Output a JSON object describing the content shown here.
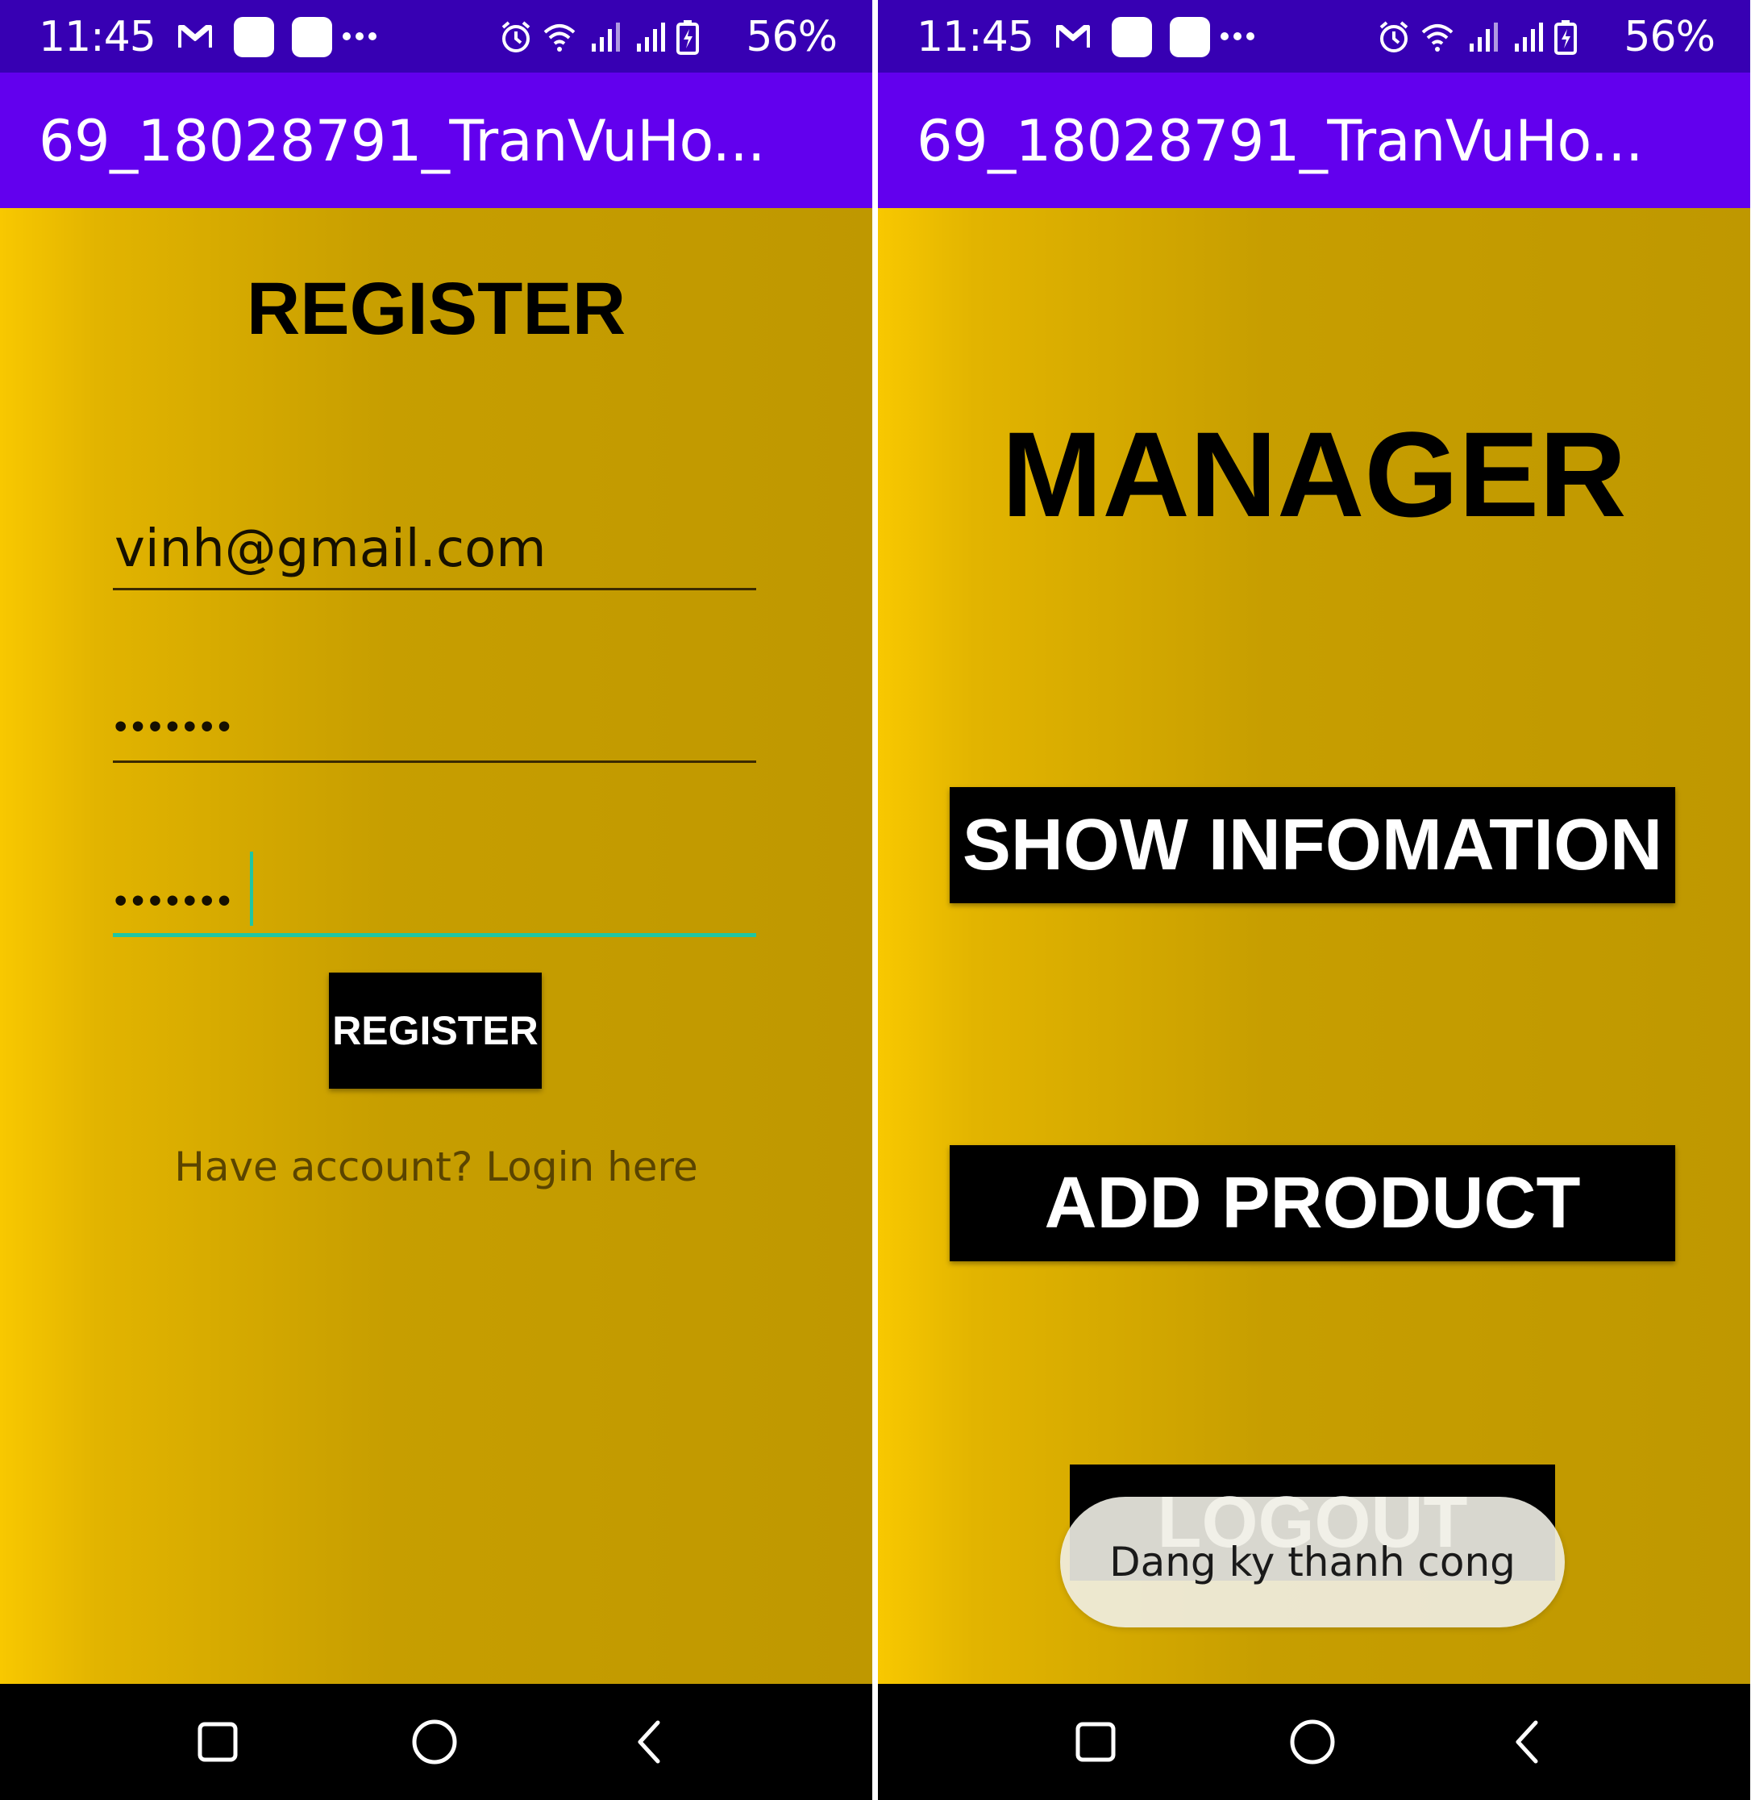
{
  "status_bar": {
    "time": "11:45",
    "battery_percent": "56%",
    "left_icons": [
      "gmail-icon",
      "app-notification-icon",
      "app-notification-icon",
      "more-notifications-icon"
    ],
    "right_icons": [
      "alarm-icon",
      "wifi-icon",
      "signal-icon",
      "signal-icon",
      "battery-charging-icon"
    ]
  },
  "app_bar": {
    "title": "69_18028791_TranVuHo..."
  },
  "register_screen": {
    "heading": "REGISTER",
    "email_value": "vinh@gmail.com",
    "password_masked": "•••••••",
    "confirm_password_masked": "•••••••",
    "register_button": "REGISTER",
    "login_link": "Have account? Login here"
  },
  "manager_screen": {
    "heading": "MANAGER",
    "show_info_button": "SHOW INFOMATION",
    "add_product_button": "ADD PRODUCT",
    "logout_button": "LOGOUT",
    "toast_message": "Dang ky thanh cong"
  },
  "navigation_bar": {
    "buttons": [
      "recent-apps-icon",
      "home-icon",
      "back-icon"
    ]
  },
  "colors": {
    "status_bar": "#3700b3",
    "app_bar": "#6200ee",
    "background_gradient_start": "#f8c800",
    "background_gradient_end": "#bf9800",
    "button": "#000000",
    "focus_accent": "#1fc6a3",
    "link_text": "#5a4400"
  }
}
